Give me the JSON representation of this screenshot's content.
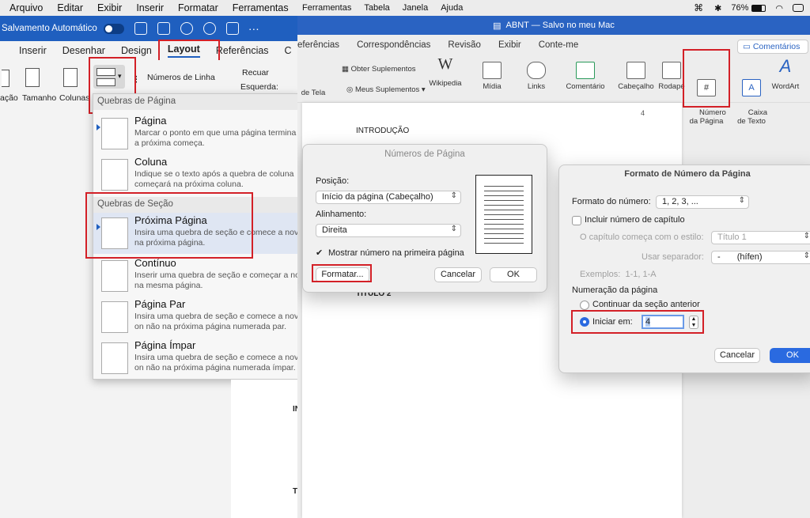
{
  "left": {
    "menubar": [
      "Arquivo",
      "Editar",
      "Exibir",
      "Inserir",
      "Formatar",
      "Ferramentas"
    ],
    "titlebar": {
      "autosave": "Salvamento Automático",
      "toggle_state": "off"
    },
    "tabs": {
      "inserir": "Inserir",
      "desenhar": "Desenhar",
      "design": "Design",
      "layout": "Layout",
      "referencias": "Referências",
      "c": "C"
    },
    "ribbon": {
      "margens": "ação",
      "tamanho": "Tamanho",
      "colunas": "Colunas",
      "numeros_linha": "Números de Linha",
      "recuar": "Recuar",
      "esquerda": "Esquerda:"
    },
    "dropdown": {
      "header_pagina": "Quebras de Página",
      "header_secao": "Quebras de Seção",
      "items": [
        {
          "title": "Página",
          "desc": "Marcar o ponto em que uma página termina\na próxima começa."
        },
        {
          "title": "Coluna",
          "desc": "Indique se o texto após a quebra de coluna\ncomeçará na próxima coluna."
        },
        {
          "title": "Próxima Página",
          "desc": "Insira uma quebra de seção e comece a nov\nna próxima página."
        },
        {
          "title": "Contínuo",
          "desc": "Inserir uma quebra de seção e começar a no\nna mesma página."
        },
        {
          "title": "Página Par",
          "desc": "Insira uma quebra de seção e comece a nov\non não na próxima página numerada par."
        },
        {
          "title": "Página Ímpar",
          "desc": "Insira uma quebra de seção e comece a nov\non não na próxima página numerada ímpar."
        }
      ]
    },
    "doc_letters": [
      "IN",
      "T"
    ]
  },
  "right": {
    "menubar": [
      "Ferramentas",
      "Tabela",
      "Janela",
      "Ajuda"
    ],
    "status": {
      "battery": "76%"
    },
    "titlebar": "ABNT — Salvo no meu Mac",
    "tabs": [
      "eferências",
      "Correspondências",
      "Revisão",
      "Exibir",
      "Conte-me"
    ],
    "comments": "Comentários",
    "ribbon": {
      "de_tela": "de Tela",
      "obter": "Obter Suplementos",
      "meus": "Meus Suplementos",
      "wikipedia": "Wikipedia",
      "midia": "Mídia",
      "links": "Links",
      "comentario": "Comentário",
      "cabecalho": "Cabeçalho",
      "rodape": "Rodapé",
      "numero": "Número\nda Página",
      "caixa": "Caixa\nde Texto",
      "wordart": "WordArt"
    },
    "doc": {
      "page_number": "4",
      "intro": "INTRODUÇÃO",
      "titulo2": "TÍTULO 2"
    },
    "dialog_numeros": {
      "title": "Números de Página",
      "posicao_label": "Posição:",
      "posicao_value": "Início da página (Cabeçalho)",
      "alinhamento_label": "Alinhamento:",
      "alinhamento_value": "Direita",
      "mostrar": "Mostrar número na primeira página",
      "mostrar_checked": true,
      "formatar": "Formatar...",
      "cancelar": "Cancelar",
      "ok": "OK"
    },
    "dialog_formato": {
      "title": "Formato de Número da Página",
      "formato_label": "Formato do número:",
      "formato_value": "1, 2, 3, ...",
      "incluir": "Incluir número de capítulo",
      "capitulo_label": "O capítulo começa com o estilo:",
      "capitulo_value": "Título 1",
      "separador_label": "Usar separador:",
      "separador_dash": "-",
      "separador_value": "(hífen)",
      "exemplos": "Exemplos:  1-1, 1-A",
      "numeracao": "Numeração da página",
      "continuar": "Continuar da seção anterior",
      "iniciar": "Iniciar em:",
      "iniciar_value": "4",
      "cancelar": "Cancelar",
      "ok": "OK"
    }
  }
}
